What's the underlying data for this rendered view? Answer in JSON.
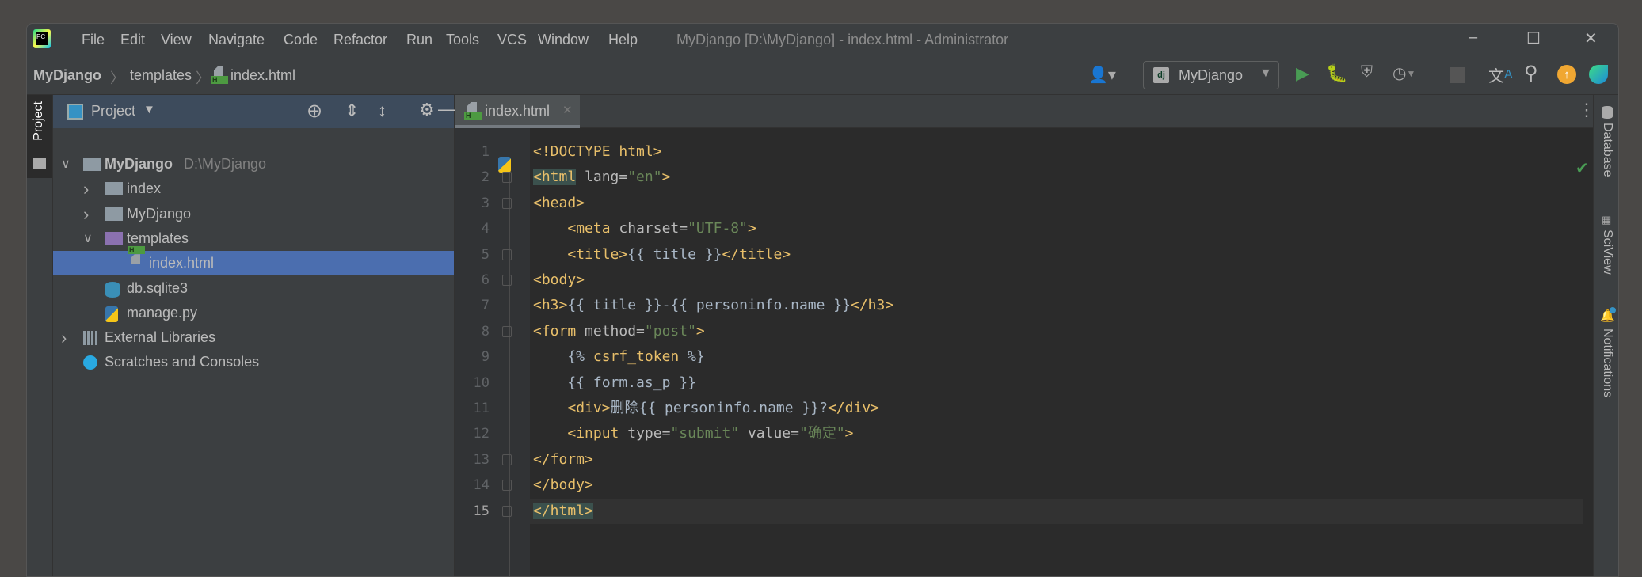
{
  "window": {
    "title": "MyDjango [D:\\MyDjango] - index.html - Administrator"
  },
  "menu": [
    "File",
    "Edit",
    "View",
    "Navigate",
    "Code",
    "Refactor",
    "Run",
    "Tools",
    "VCS",
    "Window",
    "Help"
  ],
  "breadcrumb": [
    "MyDjango",
    "templates",
    "index.html"
  ],
  "toolbar": {
    "run_config": "MyDjango"
  },
  "left_stripe": {
    "project": "Project"
  },
  "right_stripe": [
    "Database",
    "SciView",
    "Notifications"
  ],
  "project": {
    "title": "Project",
    "tree": [
      {
        "label": "MyDjango",
        "extra": "D:\\MyDjango",
        "icon": "folder-icon",
        "arrow": "expanded"
      },
      {
        "label": "index",
        "icon": "package-icon",
        "arrow": "collapsed"
      },
      {
        "label": "MyDjango",
        "icon": "package-icon",
        "arrow": "collapsed"
      },
      {
        "label": "templates",
        "icon": "templates-folder-icon",
        "arrow": "expanded"
      },
      {
        "label": "index.html",
        "icon": "html-file-icon",
        "selected": true
      },
      {
        "label": "db.sqlite3",
        "icon": "database-icon"
      },
      {
        "label": "manage.py",
        "icon": "python-file-icon"
      },
      {
        "label": "External Libraries",
        "icon": "library-icon",
        "arrow": "collapsed"
      },
      {
        "label": "Scratches and Consoles",
        "icon": "scratches-icon"
      }
    ]
  },
  "editor": {
    "tab": "index.html",
    "current_line": 15,
    "lines": [
      [
        [
          "<!DOCTYPE html>",
          "d"
        ]
      ],
      [
        [
          "<html",
          "t hl"
        ],
        [
          " lang=",
          "a"
        ],
        [
          "\"en\"",
          "s"
        ],
        [
          ">",
          "t"
        ]
      ],
      [
        [
          "<head>",
          "t"
        ]
      ],
      [
        [
          "    ",
          ""
        ],
        [
          "<meta",
          "t"
        ],
        [
          " charset=",
          "a"
        ],
        [
          "\"UTF-8\"",
          "s"
        ],
        [
          ">",
          "t"
        ]
      ],
      [
        [
          "    ",
          ""
        ],
        [
          "<title>",
          "t"
        ],
        [
          "{{ title }}",
          "x"
        ],
        [
          "</title>",
          "t"
        ]
      ],
      [
        [
          "<body>",
          "t"
        ]
      ],
      [
        [
          "<h3>",
          "t"
        ],
        [
          "{{ title }}-{{ personinfo.name }}",
          "x"
        ],
        [
          "</h3>",
          "t"
        ]
      ],
      [
        [
          "<form",
          "t"
        ],
        [
          " method=",
          "a"
        ],
        [
          "\"post\"",
          "s"
        ],
        [
          ">",
          "t"
        ]
      ],
      [
        [
          "    ",
          ""
        ],
        [
          "{% ",
          "x"
        ],
        [
          "csrf_token",
          "d"
        ],
        [
          " %}",
          "x"
        ]
      ],
      [
        [
          "    ",
          ""
        ],
        [
          "{{ form.as_p }}",
          "x"
        ]
      ],
      [
        [
          "    ",
          ""
        ],
        [
          "<div>",
          "t"
        ],
        [
          "删除{{ personinfo.name }}?",
          "x"
        ],
        [
          "</div>",
          "t"
        ]
      ],
      [
        [
          "    ",
          ""
        ],
        [
          "<input",
          "t"
        ],
        [
          " type=",
          "a"
        ],
        [
          "\"submit\"",
          "s"
        ],
        [
          " value=",
          "a"
        ],
        [
          "\"确定\"",
          "s"
        ],
        [
          ">",
          "t"
        ]
      ],
      [
        [
          "</form>",
          "t"
        ]
      ],
      [
        [
          "</body>",
          "t"
        ]
      ],
      [
        [
          "</html>",
          "t hl"
        ]
      ]
    ]
  },
  "colors": {
    "accent": "#4b6eaf",
    "tag": "#e8bf6a",
    "string": "#6a8759",
    "run": "#499c54"
  }
}
